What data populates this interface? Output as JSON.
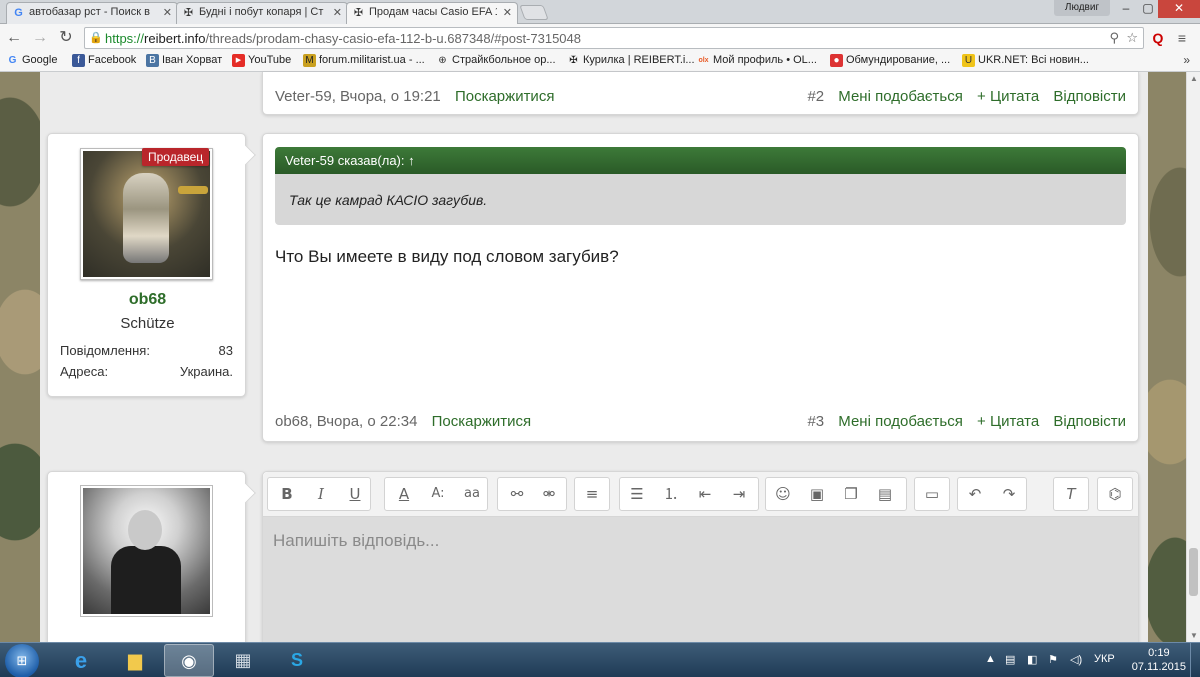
{
  "browser": {
    "tabs": [
      {
        "label": "автобазар рст - Поиск в",
        "icon": "google-icon",
        "active": false
      },
      {
        "label": "Будні і побут копаря | Ст",
        "icon": "iron-cross-icon",
        "active": false
      },
      {
        "label": "Продам часы Casio EFA 1",
        "icon": "iron-cross-icon",
        "active": true
      }
    ],
    "user_name": "Людвиг",
    "url": {
      "scheme": "https://",
      "host": "reibert.info",
      "path": "/threads/prodam-chasy-casio-efa-112-b-u.687348/#post-7315048"
    },
    "bookmarks": [
      {
        "label": "Google",
        "icon": "google-icon",
        "color": "#4285f4"
      },
      {
        "label": "Facebook",
        "icon": "facebook-icon",
        "color": "#3b5998"
      },
      {
        "label": "Іван Хорват",
        "icon": "vk-icon",
        "color": "#4c75a3"
      },
      {
        "label": "YouTube",
        "icon": "youtube-icon",
        "color": "#e52d27"
      },
      {
        "label": "forum.militarist.ua - ...",
        "icon": "militarist-icon",
        "color": "#c9a020"
      },
      {
        "label": "Страйкбольное ор...",
        "icon": "target-icon",
        "color": "#333333"
      },
      {
        "label": "Курилка | REIBERT.i...",
        "icon": "iron-cross-icon",
        "color": "#222222"
      },
      {
        "label": "Мой профиль • OL...",
        "icon": "olx-icon",
        "color": "#e85a26"
      },
      {
        "label": "Обмундирование, ...",
        "icon": "flag-icon",
        "color": "#d33"
      },
      {
        "label": "UKR.NET: Всі новин...",
        "icon": "ukrnet-icon",
        "color": "#f0c419"
      }
    ]
  },
  "prev_post": {
    "author_date": "Veter-59, Вчора, о 19:21",
    "report": "Поскаржитися",
    "number": "#2",
    "like": "Мені подобається",
    "quote": "+ Цитата",
    "reply": "Відповісти"
  },
  "post": {
    "user": {
      "badge": "Продавец",
      "name": "ob68",
      "title": "Schütze",
      "stats": [
        {
          "label": "Повідомлення:",
          "value": "83"
        },
        {
          "label": "Адреса:",
          "value": "Украина."
        }
      ]
    },
    "quote_header": "Veter-59 сказав(ла): ↑",
    "quote_text": "Так це камрад КАСІО загубив.",
    "text": "Что Вы имеете в виду под словом загубив?",
    "footer": {
      "author_date": "ob68, Вчора, о 22:34",
      "report": "Поскаржитися",
      "number": "#3",
      "like": "Мені подобається",
      "quote": "+ Цитата",
      "reply": "Відповісти"
    }
  },
  "editor": {
    "placeholder": "Напишіть відповідь..."
  },
  "taskbar": {
    "lang": "УКР",
    "time": "0:19",
    "date": "07.11.2015"
  }
}
